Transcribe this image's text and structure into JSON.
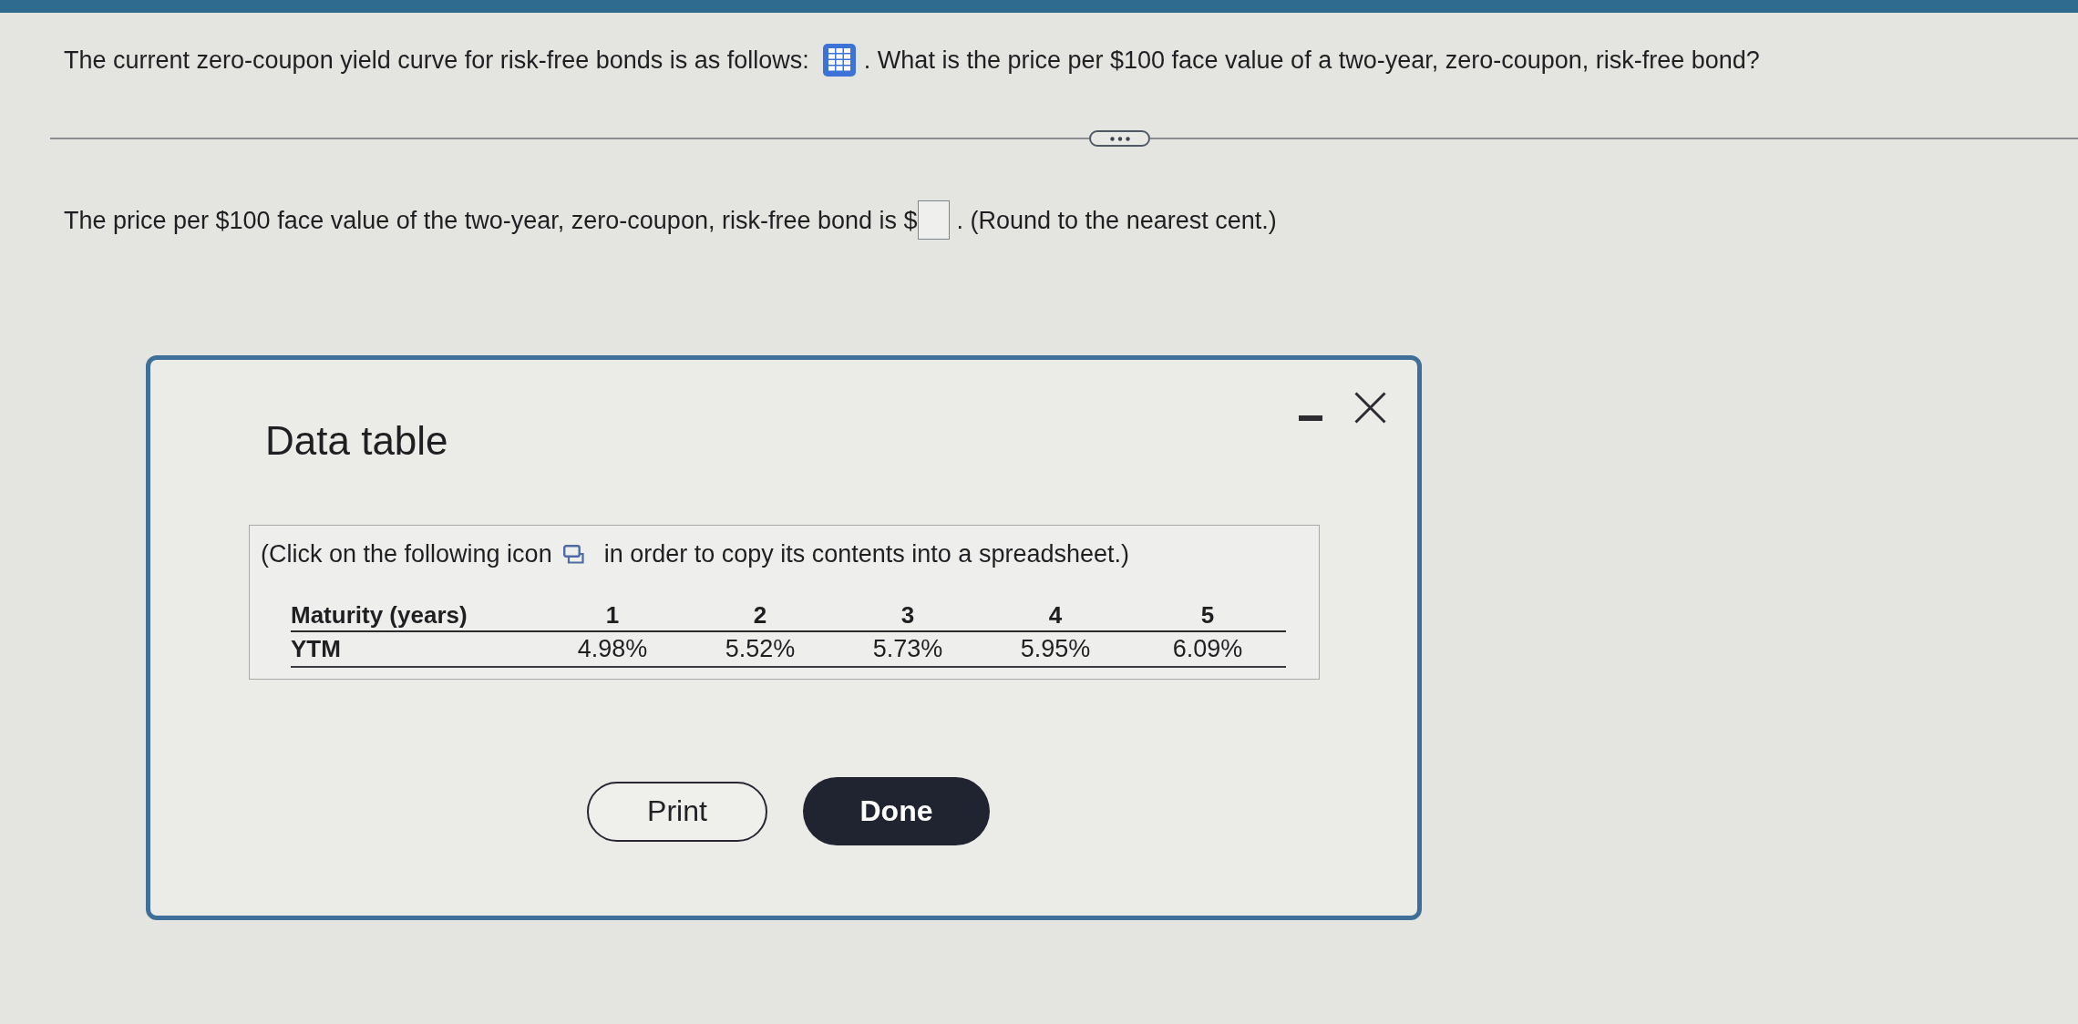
{
  "question": {
    "text_before": "The current zero-coupon yield curve for risk-free bonds is as follows:",
    "text_after": ". What is the price per $100 face value of a two-year, zero-coupon, risk-free bond?"
  },
  "answer": {
    "text_before": "The price per $100 face value of the two-year, zero-coupon, risk-free bond is $",
    "text_after": ". (Round to the nearest cent.)"
  },
  "dialog": {
    "title": "Data table",
    "instruction": {
      "text_before": "(Click on the following icon",
      "text_after": "in order to copy its contents into a spreadsheet.)"
    },
    "table": {
      "columns": [
        "Maturity (years)",
        "1",
        "2",
        "3",
        "4",
        "5"
      ],
      "rows": [
        [
          "YTM",
          "4.98%",
          "5.52%",
          "5.73%",
          "5.95%",
          "6.09%"
        ]
      ]
    },
    "buttons": [
      {
        "label": "Print",
        "kind": "outline"
      },
      {
        "label": "Done",
        "kind": "filled"
      }
    ]
  }
}
